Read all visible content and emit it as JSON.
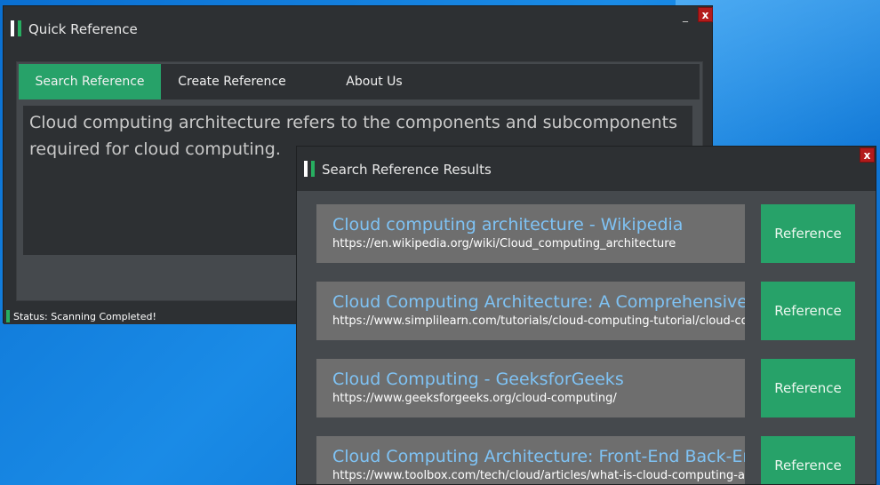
{
  "main_window": {
    "title": "Quick Reference",
    "minimize": "_",
    "close": "x",
    "tabs": [
      {
        "label": "Search Reference",
        "active": true
      },
      {
        "label": "Create Reference",
        "active": false
      },
      {
        "label": "About Us",
        "active": false
      }
    ],
    "text_content": "Cloud computing architecture refers to the components and subcomponents required for cloud computing.",
    "status": "Status: Scanning Completed!"
  },
  "results_window": {
    "title": "Search Reference Results",
    "close": "x",
    "results": [
      {
        "title": "Cloud computing architecture - Wikipedia",
        "url": "https://en.wikipedia.org/wiki/Cloud_computing_architecture",
        "button": "Reference"
      },
      {
        "title": "Cloud Computing Architecture: A Comprehensive Guide",
        "url": "https://www.simplilearn.com/tutorials/cloud-computing-tutorial/cloud-computing-architecture",
        "button": "Reference"
      },
      {
        "title": "Cloud Computing - GeeksforGeeks",
        "url": "https://www.geeksforgeeks.org/cloud-computing/",
        "button": "Reference"
      },
      {
        "title": "Cloud Computing Architecture: Front-End  Back-End Explained",
        "url": "https://www.toolbox.com/tech/cloud/articles/what-is-cloud-computing-architecture/",
        "button": "Reference"
      }
    ]
  },
  "colors": {
    "accent": "#27a269",
    "window_bg": "#2d3033",
    "panel_bg": "#45494d",
    "link": "#7fc3f5",
    "close_red": "#b31b1b"
  }
}
